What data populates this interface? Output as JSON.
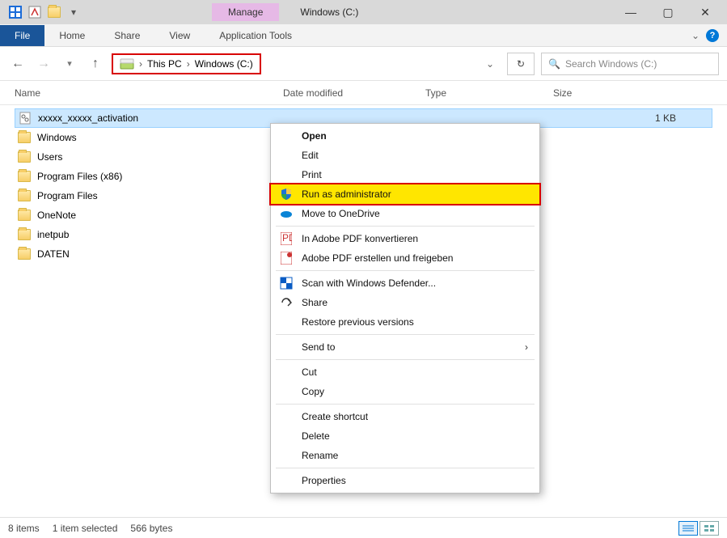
{
  "title_bar": {
    "context_tab": "Manage",
    "window_title": "Windows (C:)"
  },
  "ribbon": {
    "file": "File",
    "tabs": [
      "Home",
      "Share",
      "View"
    ],
    "context_tab": "Application Tools"
  },
  "breadcrumb": {
    "items": [
      "This PC",
      "Windows (C:)"
    ]
  },
  "search": {
    "placeholder": "Search Windows (C:)"
  },
  "columns": {
    "name": "Name",
    "date": "Date modified",
    "type": "Type",
    "size": "Size"
  },
  "files": [
    {
      "name": "xxxxx_xxxxx_activation",
      "kind": "file",
      "size": "1 KB",
      "selected": true
    },
    {
      "name": "Windows",
      "kind": "folder"
    },
    {
      "name": "Users",
      "kind": "folder"
    },
    {
      "name": "Program Files (x86)",
      "kind": "folder"
    },
    {
      "name": "Program Files",
      "kind": "folder"
    },
    {
      "name": "OneNote",
      "kind": "folder"
    },
    {
      "name": "inetpub",
      "kind": "folder"
    },
    {
      "name": "DATEN",
      "kind": "folder"
    }
  ],
  "context_menu": {
    "open": "Open",
    "edit": "Edit",
    "print": "Print",
    "run_admin": "Run as administrator",
    "move_onedrive": "Move to OneDrive",
    "adobe_convert": "In Adobe PDF konvertieren",
    "adobe_share": "Adobe PDF erstellen und freigeben",
    "defender": "Scan with Windows Defender...",
    "share": "Share",
    "restore": "Restore previous versions",
    "send_to": "Send to",
    "cut": "Cut",
    "copy": "Copy",
    "create_shortcut": "Create shortcut",
    "delete": "Delete",
    "rename": "Rename",
    "properties": "Properties"
  },
  "status": {
    "count": "8 items",
    "selection": "1 item selected",
    "size": "566 bytes"
  }
}
